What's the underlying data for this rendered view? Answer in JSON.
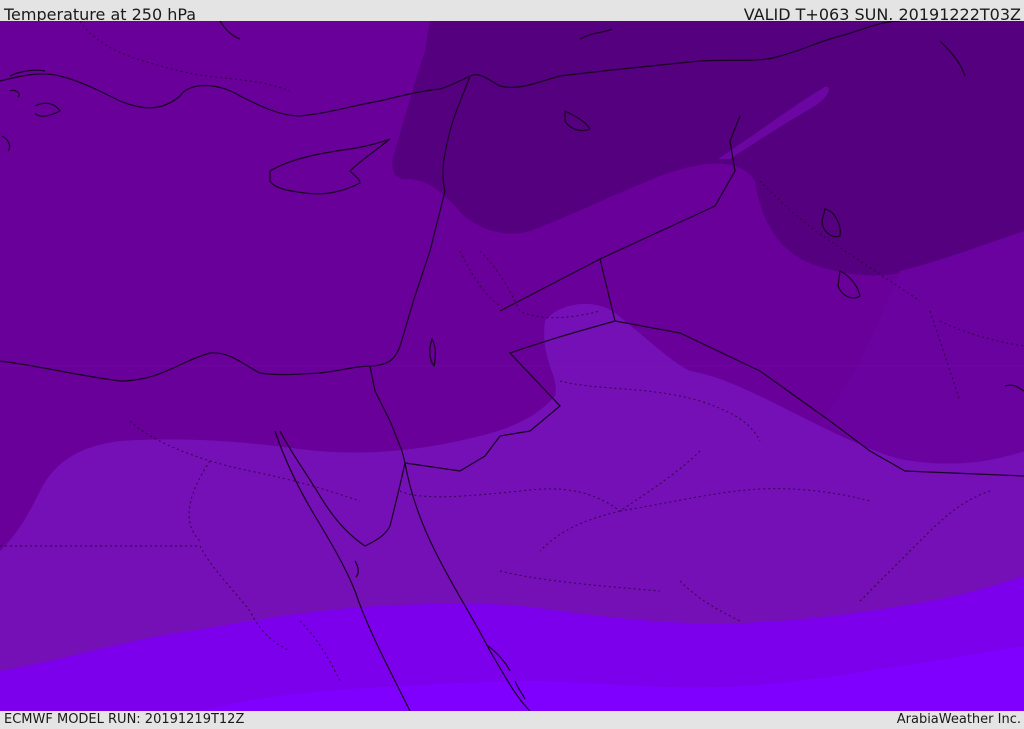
{
  "header": {
    "title": "Temperature at 250 hPa",
    "valid": "VALID T+063 SUN. 20191222T03Z"
  },
  "footer": {
    "model_run": "ECMWF MODEL RUN: 20191219T12Z",
    "credit": "ArabiaWeather Inc."
  },
  "map": {
    "region": "Eastern Mediterranean / Middle East",
    "field": "temperature",
    "level": "250 hPa",
    "colors": {
      "band_darkest": "#55007f",
      "band_dark": "#680099",
      "band_mid_light": "#7010b0",
      "band_mid": "#7512bb",
      "band_bright": "#7d00ee",
      "band_brightest": "#8000ff",
      "coastline": "#1a0022"
    }
  }
}
